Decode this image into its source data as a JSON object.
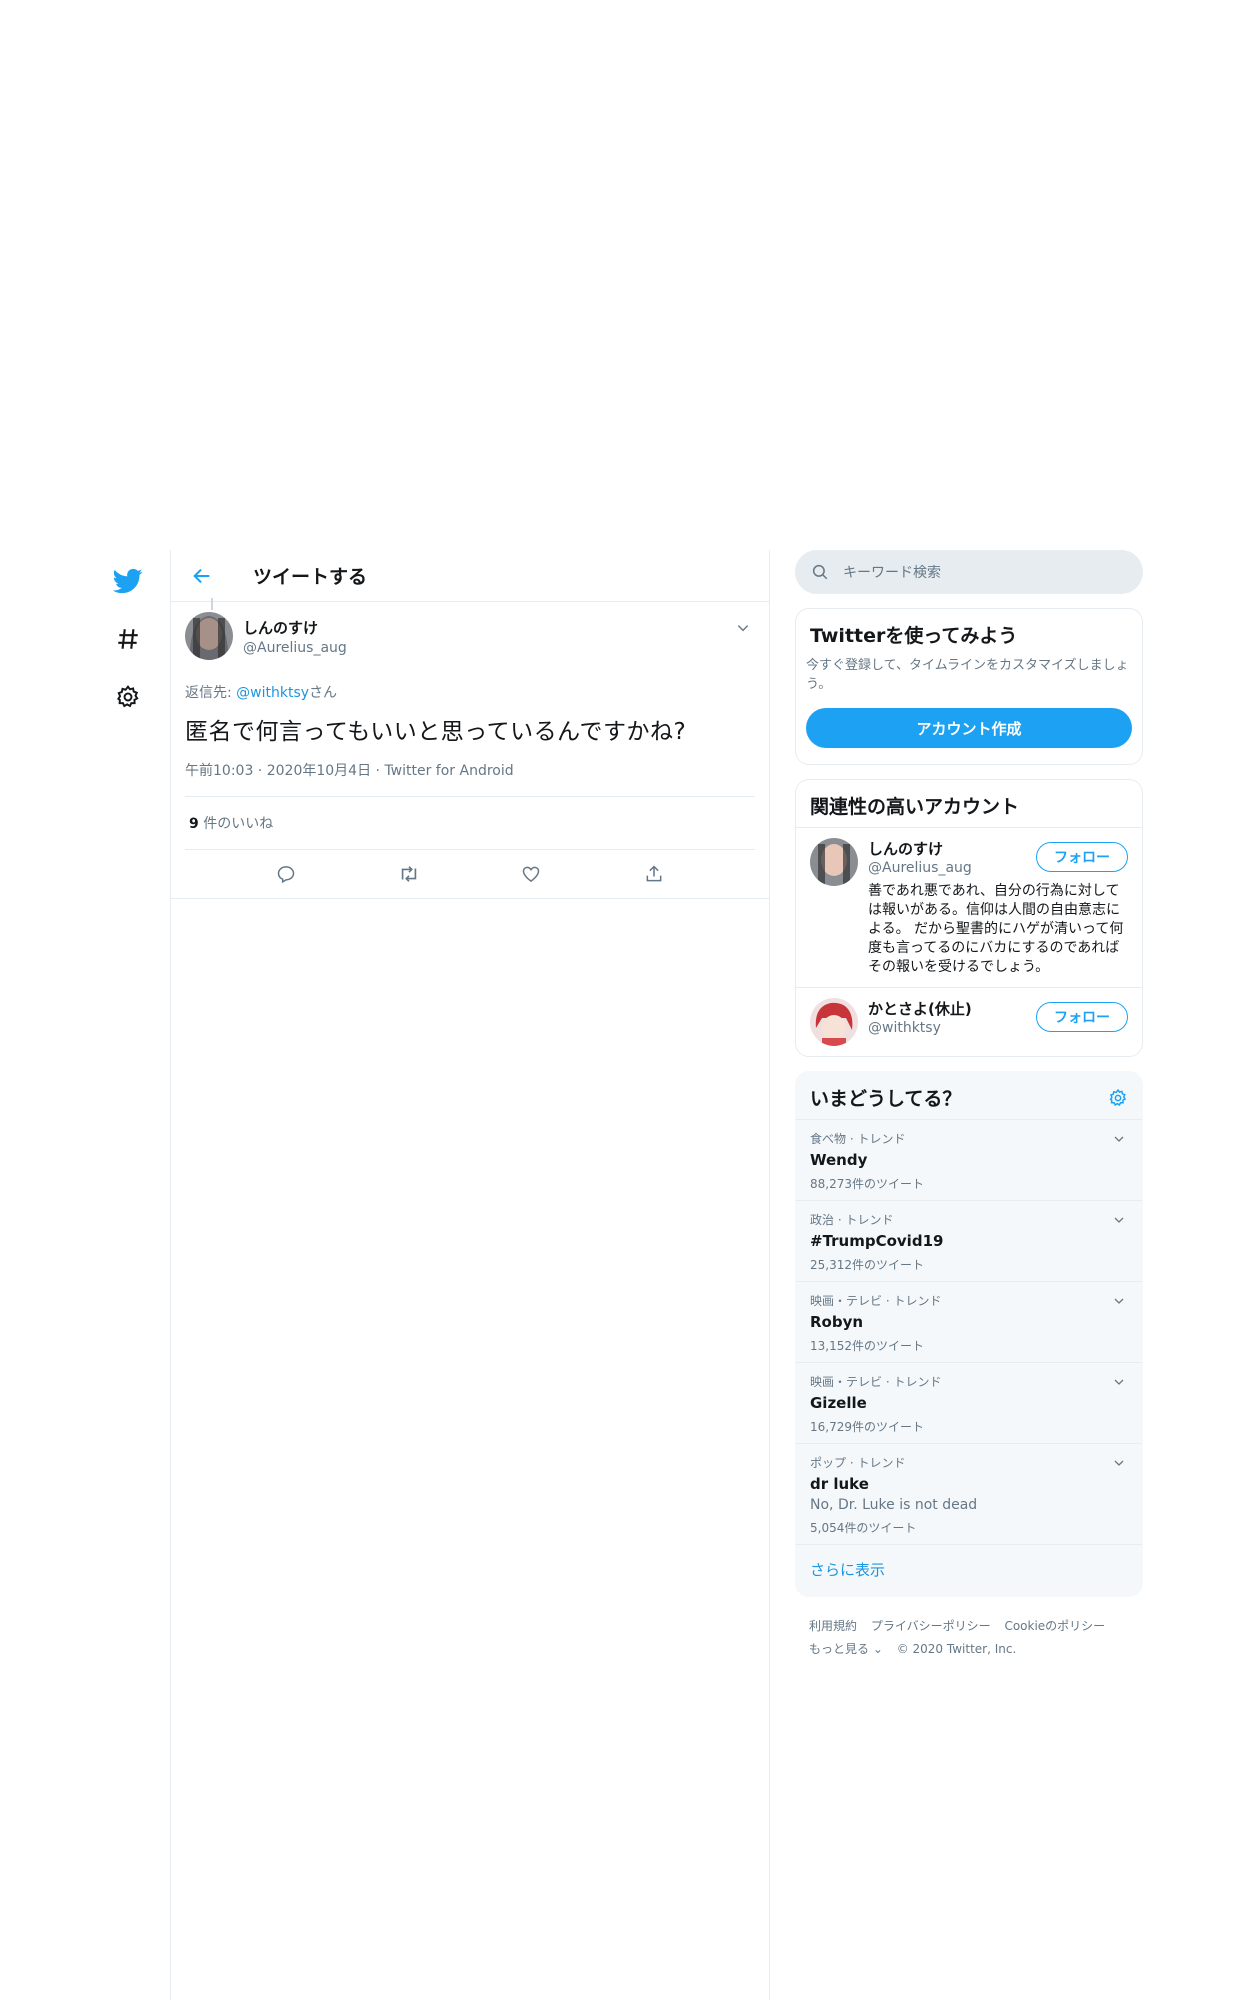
{
  "nav": {
    "items": [
      {
        "icon": "twitter-bird-icon"
      },
      {
        "icon": "hashtag-icon"
      },
      {
        "icon": "settings-gear-icon"
      }
    ]
  },
  "header": {
    "title": "ツイートする"
  },
  "tweet": {
    "display_name": "しんのすけ",
    "handle": "@Aurelius_aug",
    "reply_prefix": "返信先: ",
    "reply_mention": "@withktsy",
    "reply_suffix": "さん",
    "text": "匿名で何言ってもいいと思っているんですかね?",
    "time": "午前10:03",
    "date": "2020年10月4日",
    "source": "Twitter for Android",
    "likes_count": "9",
    "likes_label": " 件のいいね"
  },
  "search": {
    "placeholder": "キーワード検索"
  },
  "signup": {
    "title": "Twitterを使ってみよう",
    "desc": "今すぐ登録して、タイムラインをカスタマイズしましょう。",
    "button": "アカウント作成"
  },
  "related": {
    "title": "関連性の高いアカウント",
    "follow_label": "フォロー",
    "accounts": [
      {
        "name": "しんのすけ",
        "handle": "@Aurelius_aug",
        "bio": "善であれ悪であれ、自分の行為に対しては報いがある。信仰は人間の自由意志による。 だから聖書的にハゲが清いって何度も言ってるのにバカにするのであればその報いを受けるでしょう。"
      },
      {
        "name": "かとさよ(休止)",
        "handle": "@withktsy",
        "bio": ""
      }
    ]
  },
  "trends": {
    "title": "いまどうしてる？",
    "items": [
      {
        "context": "食べ物 · トレンド",
        "name": "Wendy",
        "desc": "",
        "count": "88,273件のツイート"
      },
      {
        "context": "政治 · トレンド",
        "name": "#TrumpCovid19",
        "desc": "",
        "count": "25,312件のツイート"
      },
      {
        "context": "映画・テレビ · トレンド",
        "name": "Robyn",
        "desc": "",
        "count": "13,152件のツイート"
      },
      {
        "context": "映画・テレビ · トレンド",
        "name": "Gizelle",
        "desc": "",
        "count": "16,729件のツイート"
      },
      {
        "context": "ポップ · トレンド",
        "name": "dr luke",
        "desc": "No, Dr. Luke is not dead",
        "count": "5,054件のツイート"
      }
    ],
    "show_more": "さらに表示"
  },
  "footer": {
    "terms": "利用規約",
    "privacy": "プライバシーポリシー",
    "cookie": "Cookieのポリシー",
    "more": "もっと見る ⌄",
    "copyright": "© 2020 Twitter, Inc."
  },
  "colors": {
    "accent": "#1da1f2",
    "link": "#1b95e0",
    "muted": "#657786",
    "border": "#e6ecf0"
  }
}
